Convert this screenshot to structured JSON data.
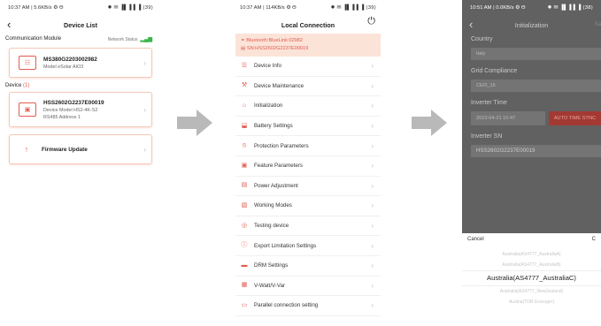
{
  "phone1": {
    "status_left": "10:37 AM | 5.6KB/s ⚙ Θ",
    "status_right": "✹ ✉ ▐▌▐ ▌▐ (39)",
    "title": "Device List",
    "comm_module_label": "Communication Module",
    "network_status_label": "Network Status",
    "signal_glyph": "▂▄▆",
    "comm_card": {
      "title": "MS380G2203002982",
      "subtitle": "Model eSolar AIO3"
    },
    "device_label": "Device",
    "device_count": "(1)",
    "device_card": {
      "title": "HSS2602G2237E00019",
      "line1": "Device Model HS2-4K-S2",
      "line2": "RS485 Address 1"
    },
    "firmware_label": "Firmware Update"
  },
  "phone2": {
    "status_left": "10:37 AM | 114KB/s ⚙ Θ",
    "status_right": "✹ ✉ ▐▌▐ ▌▐ (39)",
    "title": "Local Connection",
    "bt_name": "Bluetooth:BlueLink:02982",
    "sn": "SN:HSS2602G2237E00019",
    "menu": [
      {
        "label": "Device Info",
        "icon": "☰",
        "name": "device-info-icon"
      },
      {
        "label": "Device Maintenance",
        "icon": "⚒",
        "name": "wrench-icon"
      },
      {
        "label": "Initialization",
        "icon": "⌂",
        "name": "initialization-icon"
      },
      {
        "label": "Battery Settings",
        "icon": "⬓",
        "name": "battery-icon"
      },
      {
        "label": "Protection Parameters",
        "icon": "⦸",
        "name": "protection-icon"
      },
      {
        "label": "Feature Parameters",
        "icon": "▣",
        "name": "feature-icon"
      },
      {
        "label": "Power Adjustment",
        "icon": "▤",
        "name": "power-adjust-icon"
      },
      {
        "label": "Working Modes",
        "icon": "▧",
        "name": "working-modes-icon"
      },
      {
        "label": "Testing device",
        "icon": "◎",
        "name": "testing-icon"
      },
      {
        "label": "Export Limitation Settings",
        "icon": "ⓘ",
        "name": "export-limit-icon"
      },
      {
        "label": "DRM Settings",
        "icon": "▬",
        "name": "drm-icon"
      },
      {
        "label": "V-Watt/V-Var",
        "icon": "▦",
        "name": "vwatt-icon"
      },
      {
        "label": "Parallel connection setting",
        "icon": "▭",
        "name": "parallel-icon"
      }
    ]
  },
  "phone3": {
    "status_left": "10:51 AM | 0.0KB/s ⚙ Θ",
    "status_right": "✹ ✉ ▐▌▐ ▌▐ (38)",
    "title": "Initialization",
    "save_label": "Sa",
    "country_label": "Country",
    "country_value": "Italy",
    "grid_label": "Grid Compliance",
    "grid_value": "CEI0_16",
    "inverter_time_label": "Inverter Time",
    "inverter_time_value": "2023-04-21 10:47",
    "auto_sync_label": "AUTO TIME SYNC",
    "inverter_sn_label": "Inverter SN",
    "inverter_sn_value": "HSS2602G2237E00019",
    "cancel_label": "Cancel",
    "confirm_label": "C",
    "picker": [
      "Australia(AS4777_AustraliaA)",
      "Australia(AS4777_AustraliaB)",
      "Australia(AS4777_AustraliaC)",
      "Australia(AS4777_NewZealand)",
      "Austria(TOR Erzeuger)"
    ],
    "picker_selected": 2
  },
  "colors": {
    "accent": "#e25b4f",
    "arrow": "#b9b9b9"
  }
}
